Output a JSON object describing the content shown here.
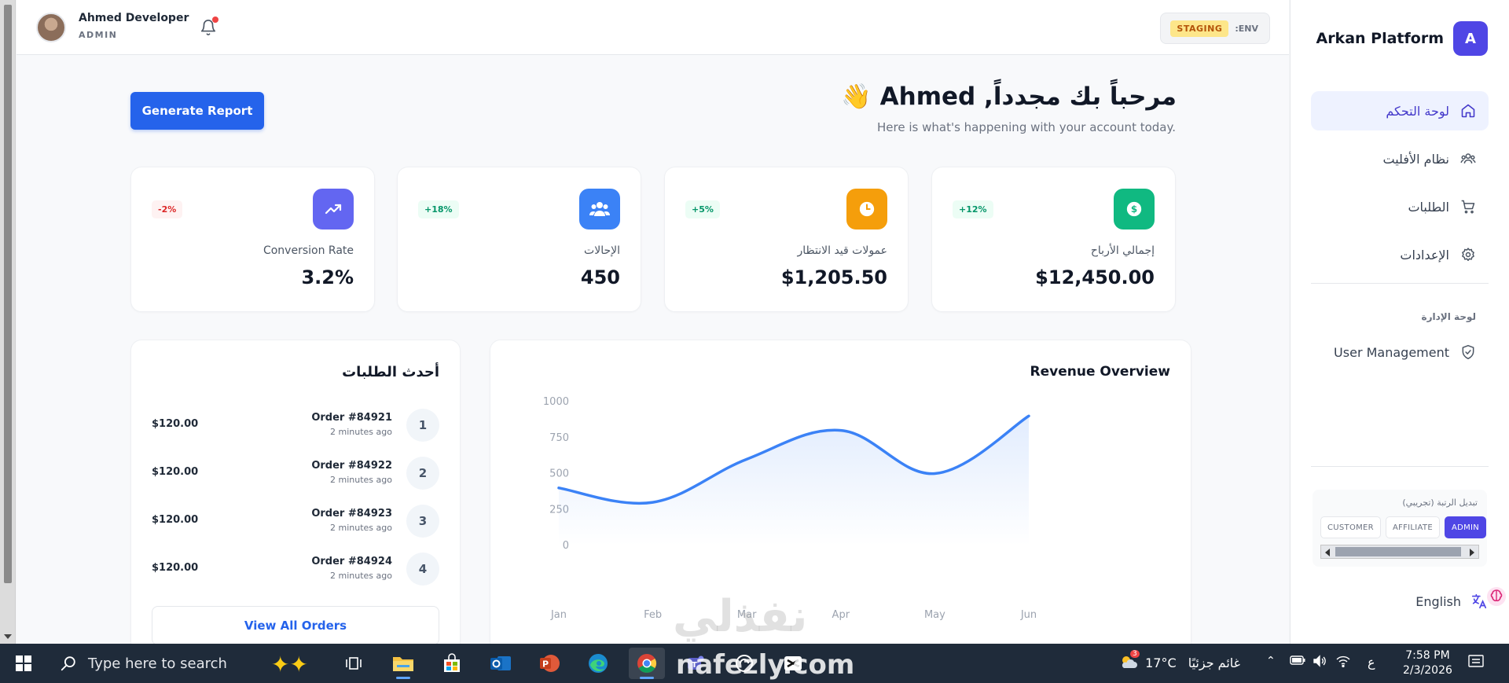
{
  "user": {
    "name": "Ahmed Developer",
    "role": "ADMIN"
  },
  "env": {
    "label": ":ENV",
    "badge": "STAGING"
  },
  "greeting": {
    "title": "مرحباً بك مجدداً, Ahmed 👋",
    "subtitle": "Here is what's happening with your account today."
  },
  "actions": {
    "generate_report": "Generate Report"
  },
  "stats": [
    {
      "label": "إجمالي الأرباح",
      "value": "$12,450.00",
      "change": "+12%",
      "trend": "up",
      "icon": "dollar-icon",
      "color": "#10b981"
    },
    {
      "label": "عمولات قيد الانتظار",
      "value": "$1,205.50",
      "change": "+5%",
      "trend": "up",
      "icon": "clock-icon",
      "color": "#f59e0b"
    },
    {
      "label": "الإحالات",
      "value": "450",
      "change": "+18%",
      "trend": "up",
      "icon": "users-icon",
      "color": "#3b82f6"
    },
    {
      "label": "Conversion Rate",
      "value": "3.2%",
      "change": "-2%",
      "trend": "down",
      "icon": "trending-up-icon",
      "color": "#6366f1"
    }
  ],
  "orders": {
    "title": "أحدث الطلبات",
    "items": [
      {
        "num": "1",
        "name": "Order #84921",
        "time": "2 minutes ago",
        "amount": "$120.00"
      },
      {
        "num": "2",
        "name": "Order #84922",
        "time": "2 minutes ago",
        "amount": "$120.00"
      },
      {
        "num": "3",
        "name": "Order #84923",
        "time": "2 minutes ago",
        "amount": "$120.00"
      },
      {
        "num": "4",
        "name": "Order #84924",
        "time": "2 minutes ago",
        "amount": "$120.00"
      }
    ],
    "view_all": "View All Orders"
  },
  "chart_data": {
    "type": "area",
    "title": "Revenue Overview",
    "categories": [
      "Jan",
      "Feb",
      "Mar",
      "Apr",
      "May",
      "Jun"
    ],
    "series": [
      {
        "values": [
          400,
          300,
          600,
          800,
          500,
          900
        ]
      }
    ],
    "yticks": [
      0,
      250,
      500,
      750,
      1000
    ],
    "ylim": [
      0,
      1000
    ],
    "grid": false,
    "line_color": "#3b82f6"
  },
  "sidebar": {
    "brand": "Arkan Platform",
    "logo_letter": "A",
    "nav": [
      {
        "label": "لوحة التحكم",
        "icon": "home-icon",
        "active": true
      },
      {
        "label": "نظام الأفليت",
        "icon": "users-icon",
        "active": false
      },
      {
        "label": "الطلبات",
        "icon": "cart-icon",
        "active": false
      },
      {
        "label": "الإعدادات",
        "icon": "gear-icon",
        "active": false
      }
    ],
    "section": "لوحة الإدارة",
    "admin_nav": {
      "label": "User Management",
      "icon": "shield-icon"
    },
    "role_switch": {
      "title": "تبديل الرتبة (تجريبي)",
      "options": [
        "CUSTOMER",
        "AFFILIATE",
        "ADMIN"
      ],
      "selected": "ADMIN"
    },
    "language": "English"
  },
  "watermark": {
    "arabic": "نفذلي",
    "latin": "nafezly.com"
  },
  "taskbar": {
    "search_placeholder": "Type here to search",
    "weather": "17°C",
    "weather_text": "غائم جزئيًا",
    "weather_badge": "3",
    "lang": "ع",
    "time": "7:58 PM",
    "date": "2/3/2026"
  }
}
